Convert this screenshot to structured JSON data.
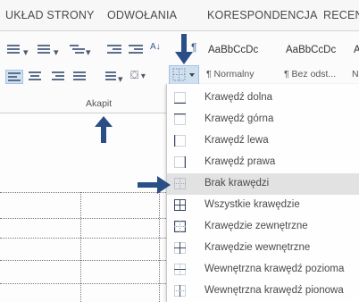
{
  "tabs": [
    "UKŁAD STRONY",
    "ODWOŁANIA",
    "KORESPONDENCJA",
    "RECENZ"
  ],
  "group_label": "Akapit",
  "styles": [
    {
      "preview": "AaBbCcDc",
      "name": "¶ Normalny"
    },
    {
      "preview": "AaBbCcDc",
      "name": "¶ Bez odst..."
    },
    {
      "preview": "A",
      "name": "N"
    }
  ],
  "borders_menu": {
    "items": [
      {
        "label": "Krawędź dolna",
        "icon": "border-bottom-icon"
      },
      {
        "label": "Krawędź górna",
        "icon": "border-top-icon"
      },
      {
        "label": "Krawędź lewa",
        "icon": "border-left-icon"
      },
      {
        "label": "Krawędź prawa",
        "icon": "border-right-icon"
      },
      {
        "label": "Brak krawędzi",
        "icon": "no-border-icon"
      },
      {
        "label": "Wszystkie krawędzie",
        "icon": "all-borders-icon"
      },
      {
        "label": "Krawędzie zewnętrzne",
        "icon": "outside-borders-icon"
      },
      {
        "label": "Krawędzie wewnętrzne",
        "icon": "inside-borders-icon"
      },
      {
        "label": "Wewnętrzna krawędź pozioma",
        "icon": "inside-horizontal-border-icon"
      },
      {
        "label": "Wewnętrzna krawędź pionowa",
        "icon": "inside-vertical-border-icon"
      }
    ],
    "highlighted_index": 4
  },
  "colors": {
    "arrow": "#2a4f86",
    "menu_highlight": "#e2e2e2",
    "button_active": "#cfe0f1"
  }
}
